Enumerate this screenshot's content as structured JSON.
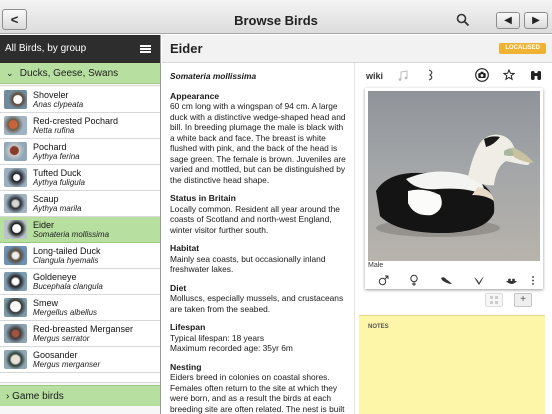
{
  "topbar": {
    "back": "<",
    "title": "Browse Birds",
    "prev": "◀",
    "next": "▶"
  },
  "sidebar": {
    "header": "All Birds, by group",
    "group": "Ducks, Geese, Swans",
    "items": [
      {
        "name": "Shoveler",
        "latin": "Anas clypeata"
      },
      {
        "name": "Red-crested Pochard",
        "latin": "Netta rufina"
      },
      {
        "name": "Pochard",
        "latin": "Aythya ferina"
      },
      {
        "name": "Tufted Duck",
        "latin": "Aythya fuligula"
      },
      {
        "name": "Scaup",
        "latin": "Aythya marila"
      },
      {
        "name": "Eider",
        "latin": "Somateria mollissima"
      },
      {
        "name": "Long-tailed Duck",
        "latin": "Clangula hyemalis"
      },
      {
        "name": "Goldeneye",
        "latin": "Bucephala clangula"
      },
      {
        "name": "Smew",
        "latin": "Mergellus albellus"
      },
      {
        "name": "Red-breasted Merganser",
        "latin": "Mergus serrator"
      },
      {
        "name": "Goosander",
        "latin": "Mergus merganser"
      }
    ],
    "next_group": "Game birds"
  },
  "main": {
    "title": "Eider",
    "badge": "LOCALISED",
    "latin": "Somateria mollissima",
    "sections": {
      "appearance": {
        "heading": "Appearance",
        "body": "60 cm long with a wingspan of 94 cm. A large duck with a distinctive wedge-shaped head and bill. In breeding plumage the male is black with a white back and face. The breast is white flushed with pink, and the back of the head is sage green. The female is brown. Juveniles are varied and mottled, but can be distinguished by the distinctive head shape."
      },
      "status": {
        "heading": "Status in Britain",
        "body": "Locally common. Resident all year around the coasts of Scotland and north-west England, winter visitor further south."
      },
      "habitat": {
        "heading": "Habitat",
        "body": "Mainly sea coasts, but occasionally inland freshwater lakes."
      },
      "diet": {
        "heading": "Diet",
        "body": "Molluscs, especially mussels, and crustaceans are taken from the seabed."
      },
      "lifespan": {
        "heading": "Lifespan",
        "line1": "Typical lifespan: 18 years",
        "line2": "Maximum recorded age: 35yr 6m"
      },
      "nesting": {
        "heading": "Nesting",
        "body": "Eiders breed in colonies on coastal shores. Females often return to the site at which they were born, and as a result the birds at each breeding site are often related. The nest is built close to the sea and lined with down."
      }
    },
    "tools": {
      "wiki": "wiki"
    },
    "photo_caption": "Male",
    "notes_label": "NOTES",
    "add_button": "+"
  }
}
